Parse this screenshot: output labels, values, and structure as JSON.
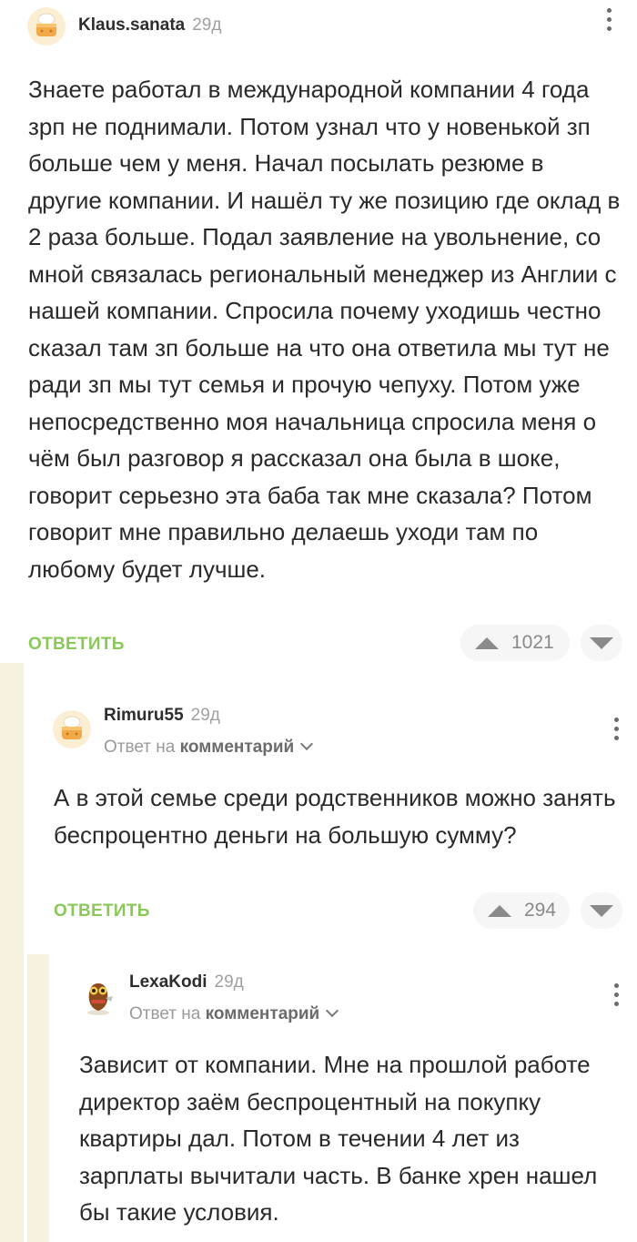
{
  "comments": [
    {
      "author": "Klaus.sanata",
      "time": "29д",
      "text": "Знаете работал в международной компании 4 года зрп не поднимали. Потом узнал что у новенькой зп больше чем у меня. Начал посылать резюме в другие компании. И нашёл ту же позицию где оклад в 2 раза больше. Подал заявление на увольнение, со мной связалась региональный менеджер из Англии с нашей компании. Спросила почему уходишь честно сказал там зп больше на что она ответила мы тут не ради зп мы тут семья и прочую чепуху. Потом уже непосредственно моя начальница спросила меня о чём был разговор я рассказал она была в шоке, говорит серьезно эта баба так мне сказала? Потом говорит мне правильно делаешь уходи там по любому будет лучше.",
      "reply_label": "ОТВЕТИТЬ",
      "votes": "1021"
    },
    {
      "author": "Rimuru55",
      "time": "29д",
      "reply_prefix": "Ответ на",
      "reply_target": "комментарий",
      "text": "А в этой семье среди родственников можно занять беспроцентно деньги на большую сумму?",
      "reply_label": "ОТВЕТИТЬ",
      "votes": "294"
    },
    {
      "author": "LexaKodi",
      "time": "29д",
      "reply_prefix": "Ответ на",
      "reply_target": "комментарий",
      "text": "Зависит от компании. Мне на прошлой работе директор заём беспроцентный на покупку квартиры дал. Потом в течении 4 лет из зарплаты вычитали часть. В банке хрен нашел бы такие условия."
    }
  ],
  "colors": {
    "accent_green": "#8ac858",
    "thread_line": "#f7f1e0",
    "muted": "#9a9a9a"
  },
  "icons": {
    "menu": "three-dots-vertical-icon",
    "upvote": "triangle-up-icon",
    "downvote": "triangle-down-icon",
    "expand": "chevron-down-icon"
  }
}
